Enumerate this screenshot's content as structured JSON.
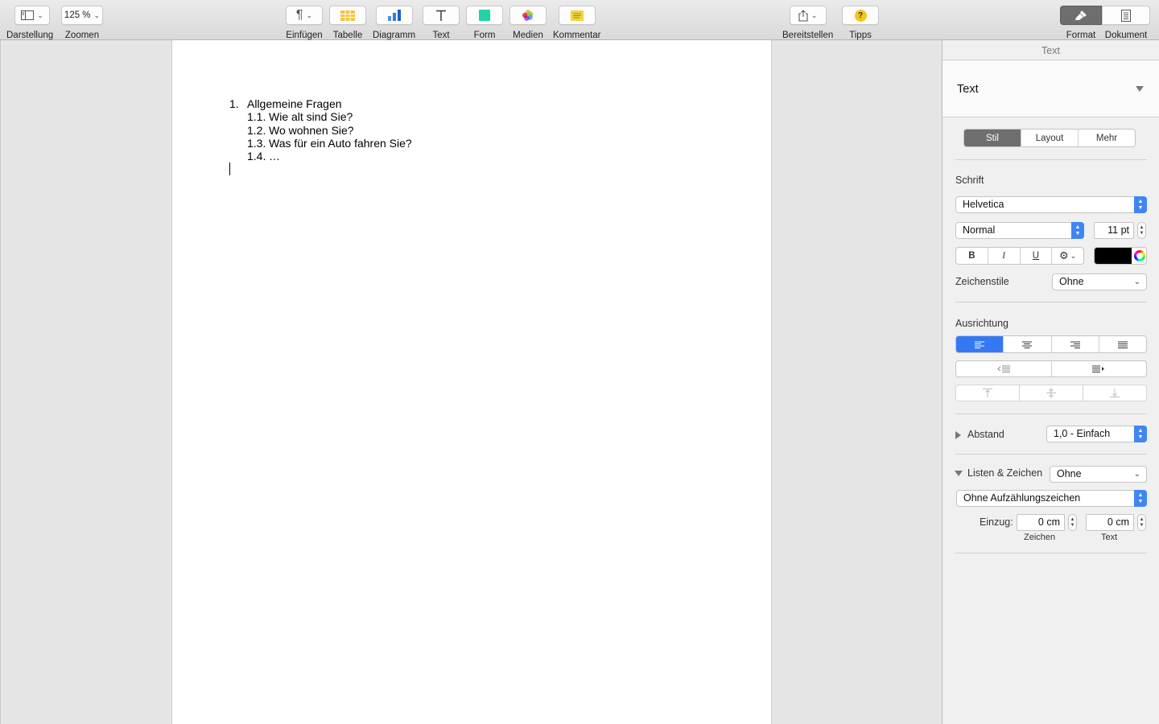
{
  "toolbar": {
    "view": {
      "label": "Darstellung",
      "icon": "sidebar-icon"
    },
    "zoom": {
      "label": "Zoomen",
      "value": "125 %"
    },
    "insert": {
      "label": "Einfügen",
      "icon": "paragraph-icon"
    },
    "table": {
      "label": "Tabelle",
      "icon": "table-icon",
      "color": "#f4c542"
    },
    "chart": {
      "label": "Diagramm",
      "icon": "bar-chart-icon",
      "color": "#2f7de1"
    },
    "text": {
      "label": "Text",
      "icon": "text-icon"
    },
    "shape": {
      "label": "Form",
      "icon": "shape-icon",
      "color": "#1fd3a3"
    },
    "media": {
      "label": "Medien",
      "icon": "photos-icon"
    },
    "comment": {
      "label": "Kommentar",
      "icon": "comment-icon",
      "color": "#f5d33b"
    },
    "share": {
      "label": "Bereitstellen",
      "icon": "share-icon"
    },
    "tips": {
      "label": "Tipps",
      "icon": "help-icon",
      "glyph": "?",
      "color": "#f5c518"
    },
    "format": {
      "label": "Format",
      "icon": "paintbrush-icon"
    },
    "document": {
      "label": "Dokument",
      "icon": "document-icon"
    }
  },
  "document": {
    "list": [
      {
        "num": "1.",
        "text": "Allgemeine Fragen"
      },
      {
        "num": "1.1.",
        "text": "Wie alt sind Sie?"
      },
      {
        "num": "1.2.",
        "text": "Wo wohnen Sie?"
      },
      {
        "num": "1.3.",
        "text": "Was für ein Auto fahren Sie?"
      },
      {
        "num": "1.4.",
        "text": "…"
      }
    ]
  },
  "inspector": {
    "title": "Text",
    "paragraph_style": "Text",
    "tabs": [
      "Stil",
      "Layout",
      "Mehr"
    ],
    "font_section": "Schrift",
    "font_family": "Helvetica",
    "font_typeface": "Normal",
    "font_size": "11 pt",
    "bold": "B",
    "italic": "I",
    "underline": "U",
    "text_color": "#000000",
    "char_styles_label": "Zeichenstile",
    "char_styles_value": "Ohne",
    "alignment_section": "Ausrichtung",
    "spacing_label": "Abstand",
    "spacing_value": "1,0 - Einfach",
    "lists_label": "Listen & Zeichen",
    "lists_value": "Ohne",
    "bullets_value": "Ohne Aufzählungszeichen",
    "indent_label": "Einzug:",
    "indent_chars_value": "0 cm",
    "indent_text_value": "0 cm",
    "indent_chars_caption": "Zeichen",
    "indent_text_caption": "Text"
  }
}
